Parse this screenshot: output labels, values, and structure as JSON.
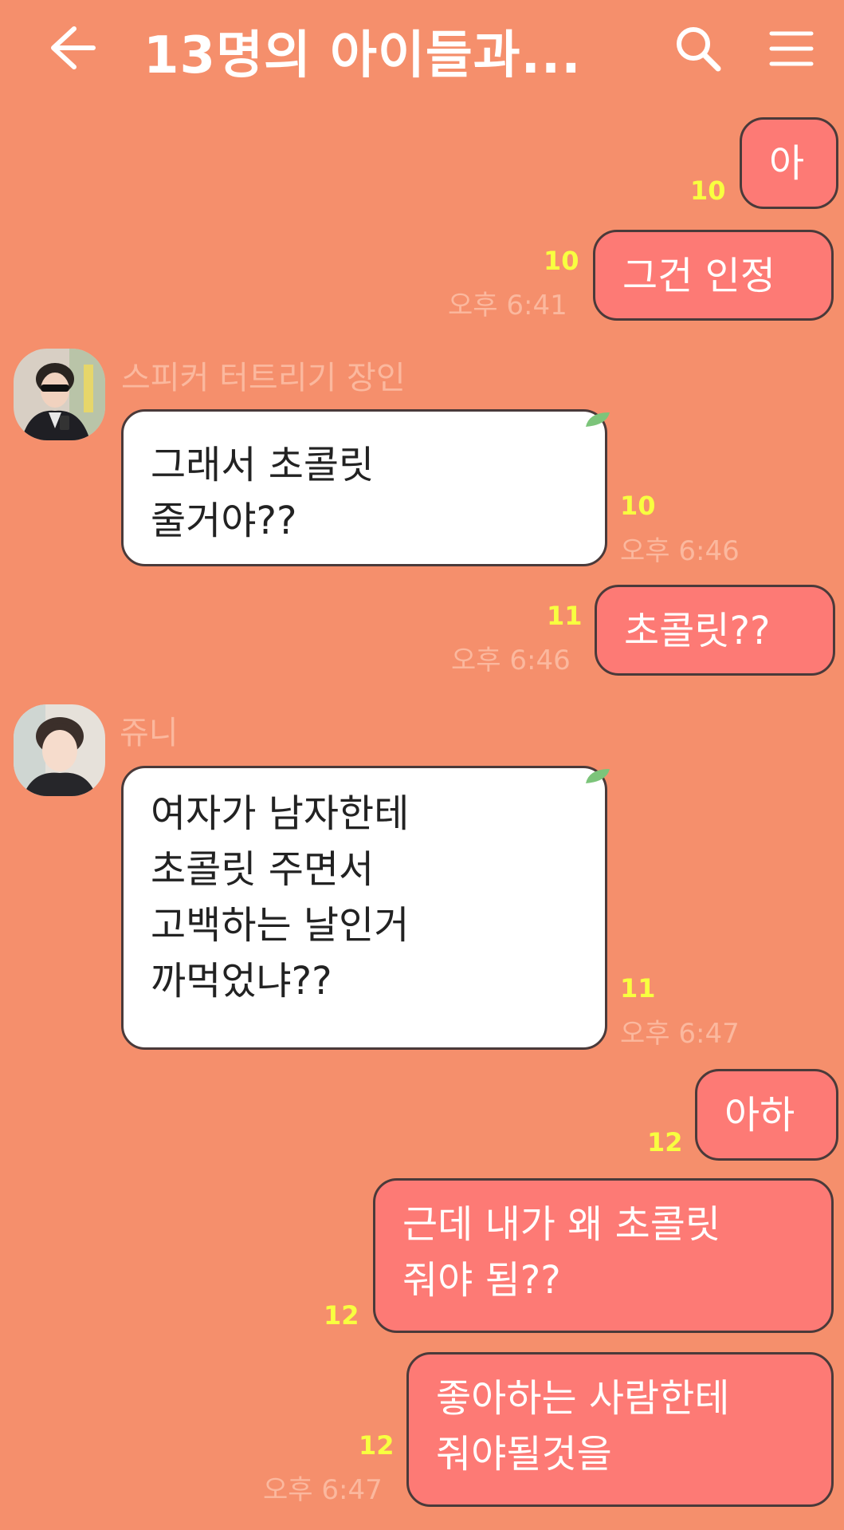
{
  "header": {
    "title": "13명의 아이들과...",
    "back_icon": "arrow-left-icon",
    "search_icon": "search-icon",
    "menu_icon": "hamburger-menu-icon"
  },
  "colors": {
    "background": "#f58f6c",
    "my_bubble": "#fd7a75",
    "their_bubble": "#ffffff",
    "unread_count": "#f8ff40",
    "meta_text": "#fbb89e"
  },
  "messages": [
    {
      "sender": "me",
      "text": "아",
      "unread": "10",
      "time": ""
    },
    {
      "sender": "me",
      "text": "그건 인정",
      "unread": "10",
      "time": "오후 6:41"
    },
    {
      "sender": "스피커 터트리기 장인",
      "text": "그래서 초콜릿\n줄거야??",
      "unread": "10",
      "time": "오후 6:46"
    },
    {
      "sender": "me",
      "text": "초콜릿??",
      "unread": "11",
      "time": "오후 6:46"
    },
    {
      "sender": "쥬니",
      "text": "여자가 남자한테\n초콜릿 주면서\n고백하는 날인거\n까먹었냐??",
      "unread": "11",
      "time": "오후 6:47"
    },
    {
      "sender": "me",
      "text": "아하",
      "unread": "12",
      "time": ""
    },
    {
      "sender": "me",
      "text": "근데 내가 왜 초콜릿\n줘야 됨??",
      "unread": "12",
      "time": ""
    },
    {
      "sender": "me",
      "text": "좋아하는 사람한테\n줘야될것을",
      "unread": "12",
      "time": "오후 6:47"
    }
  ]
}
